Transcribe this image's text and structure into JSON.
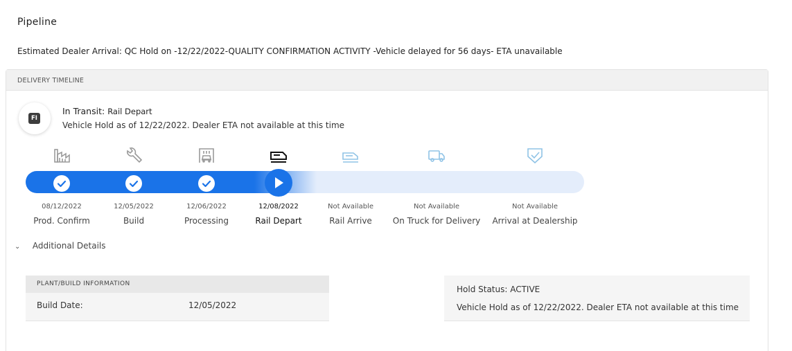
{
  "page": {
    "title": "Pipeline",
    "eta_text": "Estimated Dealer Arrival: QC Hold on -12/22/2022-QUALITY CONFIRMATION ACTIVITY -Vehicle delayed for 56 days- ETA unavailable"
  },
  "timeline": {
    "header": "DELIVERY TIMELINE",
    "badge": "FI",
    "status_label": "In Transit:",
    "status_value": "Rail Depart",
    "hold_text": "Vehicle Hold as of 12/22/2022. Dealer ETA not available at this time",
    "stages": [
      {
        "name": "Prod. Confirm",
        "date": "08/12/2022",
        "state": "complete",
        "icon": "factory-icon"
      },
      {
        "name": "Build",
        "date": "12/05/2022",
        "state": "complete",
        "icon": "wrench-icon"
      },
      {
        "name": "Processing",
        "date": "12/06/2022",
        "state": "complete",
        "icon": "car-wash-icon"
      },
      {
        "name": "Rail Depart",
        "date": "12/08/2022",
        "state": "current",
        "icon": "train-icon"
      },
      {
        "name": "Rail Arrive",
        "date": "Not Available",
        "state": "pending",
        "icon": "train-arrive-icon"
      },
      {
        "name": "On Truck for Delivery",
        "date": "Not Available",
        "state": "pending",
        "icon": "truck-icon"
      },
      {
        "name": "Arrival at Dealership",
        "date": "Not Available",
        "state": "pending",
        "icon": "shield-check-icon"
      }
    ],
    "additional_details_label": "Additional Details"
  },
  "plant": {
    "header": "PLANT/BUILD INFORMATION",
    "build_date_label": "Build Date:",
    "build_date_value": "12/05/2022"
  },
  "hold": {
    "status": "Hold Status: ACTIVE",
    "message": "Vehicle Hold as of 12/22/2022. Dealer ETA not available at this time"
  },
  "colors": {
    "progress_active": "#1a73e8",
    "progress_pending": "#e4edfb",
    "icon_done": "#9a9a9a",
    "icon_pending": "#8fc3e6"
  }
}
